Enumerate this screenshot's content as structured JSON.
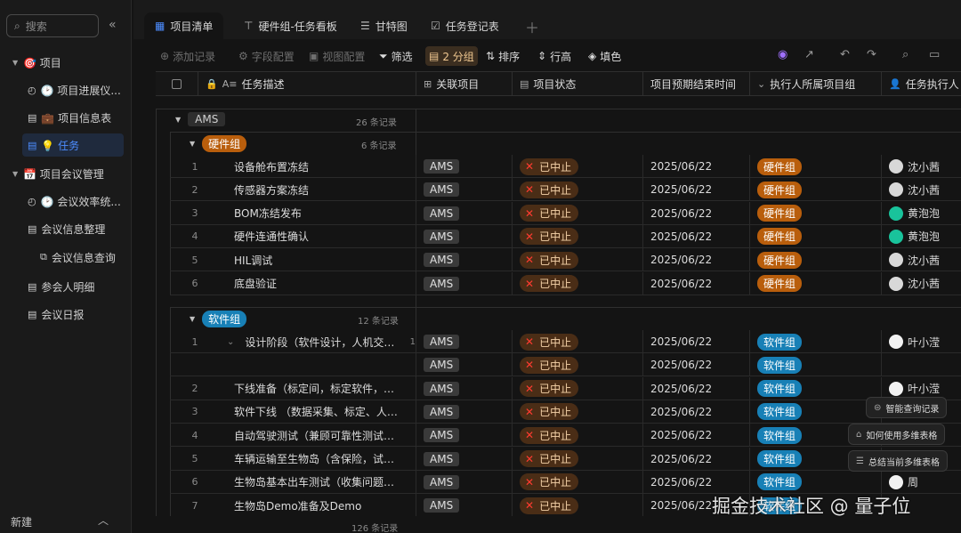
{
  "sidebar": {
    "search_placeholder": "搜索",
    "items": [
      {
        "label": "🎯 项目"
      },
      {
        "label": "🕑 项目进展仪..."
      },
      {
        "label": "💼 项目信息表"
      },
      {
        "label": "💡 任务"
      },
      {
        "label": "📅 项目会议管理"
      },
      {
        "label": "🕑 会议效率统..."
      },
      {
        "label": "会议信息整理"
      },
      {
        "label": "会议信息查询"
      },
      {
        "label": "参会人明细"
      },
      {
        "label": "会议日报"
      }
    ],
    "new_label": "新建"
  },
  "tabs": [
    {
      "label": "项目清单"
    },
    {
      "label": "硬件组-任务看板"
    },
    {
      "label": "甘特图"
    },
    {
      "label": "任务登记表"
    }
  ],
  "toolbar": {
    "add_record": "添加记录",
    "field_config": "字段配置",
    "view_config": "视图配置",
    "filter": "筛选",
    "group": "2 分组",
    "sort": "排序",
    "row_height": "行高",
    "fill": "填色"
  },
  "columns": {
    "desc": "任务描述",
    "project": "关联项目",
    "status": "项目状态",
    "end_time": "项目预期结束时间",
    "owner_group": "执行人所属项目组",
    "owner": "任务执行人"
  },
  "groups": {
    "ams": {
      "tag": "AMS",
      "count": "26 条记录"
    },
    "hw": {
      "tag": "硬件组",
      "count": "6 条记录"
    },
    "sw": {
      "tag": "软件组",
      "count": "12 条记录"
    }
  },
  "hw_rows": [
    {
      "n": "1",
      "desc": "设备舱布置冻结",
      "project": "AMS",
      "status": "已中止",
      "date": "2025/06/22",
      "team": "硬件组",
      "person": "沈小茜"
    },
    {
      "n": "2",
      "desc": "传感器方案冻结",
      "project": "AMS",
      "status": "已中止",
      "date": "2025/06/22",
      "team": "硬件组",
      "person": "沈小茜"
    },
    {
      "n": "3",
      "desc": "BOM冻结发布",
      "project": "AMS",
      "status": "已中止",
      "date": "2025/06/22",
      "team": "硬件组",
      "person": "黄泡泡"
    },
    {
      "n": "4",
      "desc": "硬件连通性确认",
      "project": "AMS",
      "status": "已中止",
      "date": "2025/06/22",
      "team": "硬件组",
      "person": "黄泡泡"
    },
    {
      "n": "5",
      "desc": "HIL调试",
      "project": "AMS",
      "status": "已中止",
      "date": "2025/06/22",
      "team": "硬件组",
      "person": "沈小茜"
    },
    {
      "n": "6",
      "desc": "底盘验证",
      "project": "AMS",
      "status": "已中止",
      "date": "2025/06/22",
      "team": "硬件组",
      "person": "沈小茜"
    }
  ],
  "sw_rows": [
    {
      "n": "1",
      "desc": "设计阶段（软件设计，人机交互...",
      "sub": "1",
      "project": "AMS",
      "status": "已中止",
      "date": "2025/06/22",
      "team": "软件组",
      "person": "叶小滢"
    },
    {
      "n": "",
      "desc": "",
      "project": "AMS",
      "status": "已中止",
      "date": "2025/06/22",
      "team": "软件组",
      "person": ""
    },
    {
      "n": "2",
      "desc": "下线准备（标定间，标定软件，安全...",
      "project": "AMS",
      "status": "已中止",
      "date": "2025/06/22",
      "team": "软件组",
      "person": "叶小滢"
    },
    {
      "n": "3",
      "desc": "软件下线 （数据采集、标定、人机交...",
      "project": "AMS",
      "status": "已中止",
      "date": "2025/06/22",
      "team": "软件组",
      "person": ""
    },
    {
      "n": "4",
      "desc": "自动驾驶测试（兼顾可靠性测试，试...",
      "project": "AMS",
      "status": "已中止",
      "date": "2025/06/22",
      "team": "软件组",
      "person": ""
    },
    {
      "n": "5",
      "desc": "车辆运输至生物岛（含保险，试验牌...",
      "project": "AMS",
      "status": "已中止",
      "date": "2025/06/22",
      "team": "软件组",
      "person": ""
    },
    {
      "n": "6",
      "desc": "生物岛基本出车测试（收集问题，为...",
      "project": "AMS",
      "status": "已中止",
      "date": "2025/06/22",
      "team": "软件组",
      "person": "周"
    },
    {
      "n": "7",
      "desc": "生物岛Demo准备及Demo",
      "project": "AMS",
      "status": "已中止",
      "date": "2025/06/22",
      "team": "软件组",
      "person": ""
    }
  ],
  "footer": {
    "total": "126 条记录"
  },
  "floating": {
    "smart_query": "智能查询记录",
    "how_to": "如何使用多维表格",
    "summary": "总结当前多维表格"
  },
  "watermark": "掘金技术社区 @ 量子位"
}
